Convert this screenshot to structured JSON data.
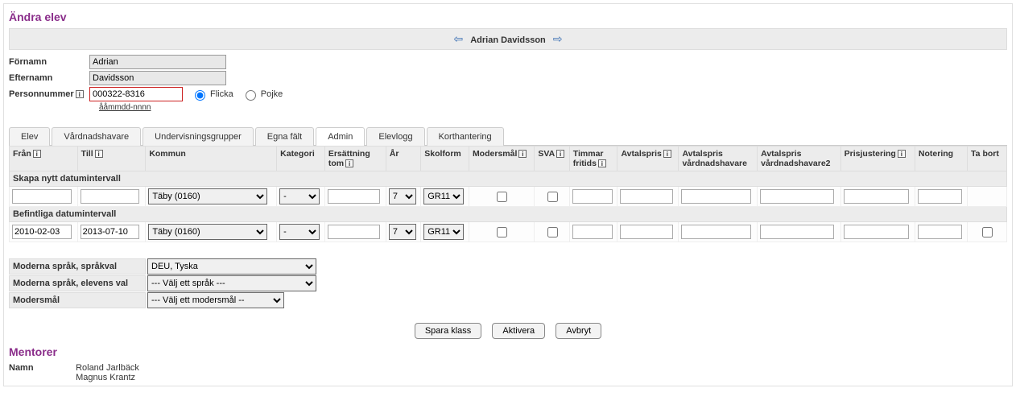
{
  "page_title": "Ändra elev",
  "nav": {
    "student_name": "Adrian Davidsson"
  },
  "fields": {
    "fornamn_label": "Förnamn",
    "fornamn_value": "Adrian",
    "efternamn_label": "Efternamn",
    "efternamn_value": "Davidsson",
    "personnummer_label": "Personnummer",
    "personnummer_value": "000322-8316",
    "personnummer_hint": "ååmmdd-nnnn",
    "gender_flicka": "Flicka",
    "gender_pojke": "Pojke"
  },
  "tabs": {
    "elev": "Elev",
    "vardnadshavare": "Vårdnadshavare",
    "undervisningsgrupper": "Undervisningsgrupper",
    "egna_falt": "Egna fält",
    "admin": "Admin",
    "elevlogg": "Elevlogg",
    "korthantering": "Korthantering"
  },
  "grid": {
    "headers": {
      "fran": "Från",
      "till": "Till",
      "kommun": "Kommun",
      "kategori": "Kategori",
      "ersattning": "Ersättning tom",
      "ar": "År",
      "skolform": "Skolform",
      "modersmal": "Modersmål",
      "sva": "SVA",
      "timmar": "Timmar fritids",
      "avtalspris": "Avtalspris",
      "avt_vh": "Avtalspris vårdnadshavare",
      "avt_vh2": "Avtalspris vårdnadshavare2",
      "prisjustering": "Prisjustering",
      "notering": "Notering",
      "tabort": "Ta bort"
    },
    "section_new": "Skapa nytt datumintervall",
    "section_existing": "Befintliga datumintervall",
    "rows": [
      {
        "fran": "",
        "till": "",
        "kommun": "Täby (0160)",
        "kategori": "-",
        "ersattning": "",
        "ar": "7",
        "skolform": "GR11",
        "timmar": "",
        "avtalspris": "",
        "avt_vh": "",
        "avt_vh2": "",
        "prisjustering": "",
        "notering": ""
      },
      {
        "fran": "2010-02-03",
        "till": "2013-07-10",
        "kommun": "Täby (0160)",
        "kategori": "-",
        "ersattning": "",
        "ar": "7",
        "skolform": "GR11",
        "timmar": "",
        "avtalspris": "",
        "avt_vh": "",
        "avt_vh2": "",
        "prisjustering": "",
        "notering": ""
      }
    ]
  },
  "lang": {
    "sprakval_label": "Moderna språk, språkval",
    "sprakval_value": "DEU, Tyska",
    "elevens_label": "Moderna språk, elevens val",
    "elevens_value": "--- Välj ett språk ---",
    "modersmal_label": "Modersmål",
    "modersmal_value": "--- Välj ett modersmål --"
  },
  "actions": {
    "spara": "Spara klass",
    "aktivera": "Aktivera",
    "avbryt": "Avbryt"
  },
  "mentors": {
    "heading": "Mentorer",
    "namn_label": "Namn",
    "m1": "Roland Jarlbäck",
    "m2": "Magnus Krantz"
  }
}
